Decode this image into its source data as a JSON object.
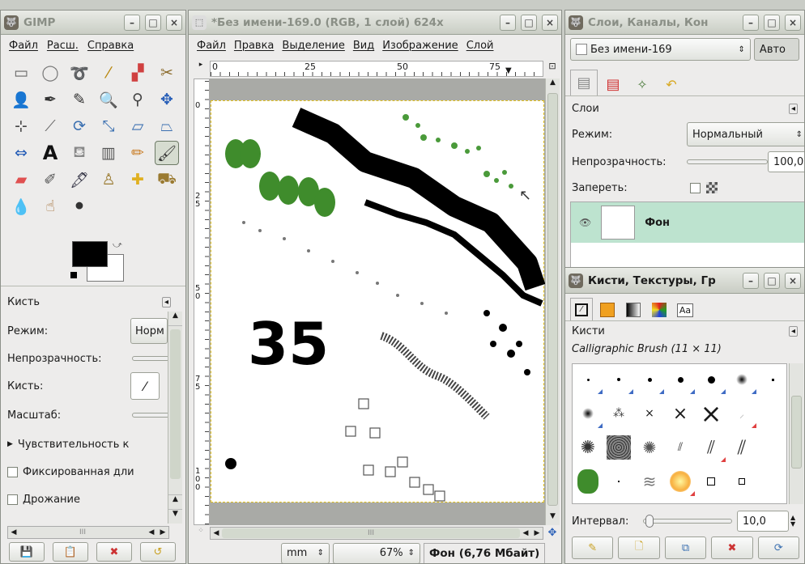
{
  "toolbox": {
    "title": "GIMP",
    "menu": [
      "Файл",
      "Расш.",
      "Справка"
    ],
    "opts_title": "Кисть",
    "mode_label": "Режим:",
    "mode_value": "Норм",
    "opacity_label": "Непрозрачность:",
    "brush_label": "Кисть:",
    "scale_label": "Масштаб:",
    "sensitivity_label": "Чувствительность к",
    "fixed_label": "Фиксированная дли",
    "jitter_label": "Дрожание",
    "scroll_mark": "III"
  },
  "image": {
    "title": "*Без имени-169.0 (RGB, 1 слой) 624x",
    "menu": [
      "Файл",
      "Правка",
      "Выделение",
      "Вид",
      "Изображение",
      "Слой"
    ],
    "ruler_h": [
      "0",
      "25",
      "50",
      "75"
    ],
    "ruler_v": [
      "0",
      "2 5",
      "5 0",
      "7 5",
      "1 0 0"
    ],
    "canvas_text": "35",
    "unit": "mm",
    "zoom": "67%",
    "status": "Фон (6,76 Мбайт)",
    "scroll_mark": "III"
  },
  "layers": {
    "title": "Слои, Каналы, Кон",
    "image_name": "Без имени-169",
    "auto_label": "Авто",
    "section": "Слои",
    "mode_label": "Режим:",
    "mode_value": "Нормальный",
    "opacity_label": "Непрозрачность:",
    "opacity_value": "100,0",
    "lock_label": "Запереть:",
    "layer_name": "Фон"
  },
  "brushes": {
    "title": "Кисти, Текстуры, Гр",
    "section": "Кисти",
    "brush_name": "Calligraphic Brush (11 × 11)",
    "font_tab": "Aa",
    "spacing_label": "Интервал:",
    "spacing_value": "10,0"
  },
  "colors": {
    "fg": "#000000",
    "bg": "#ffffff",
    "title_text": "#8a8f86",
    "selection": "#c9e8d7",
    "layer_row": "#bde3cf"
  }
}
